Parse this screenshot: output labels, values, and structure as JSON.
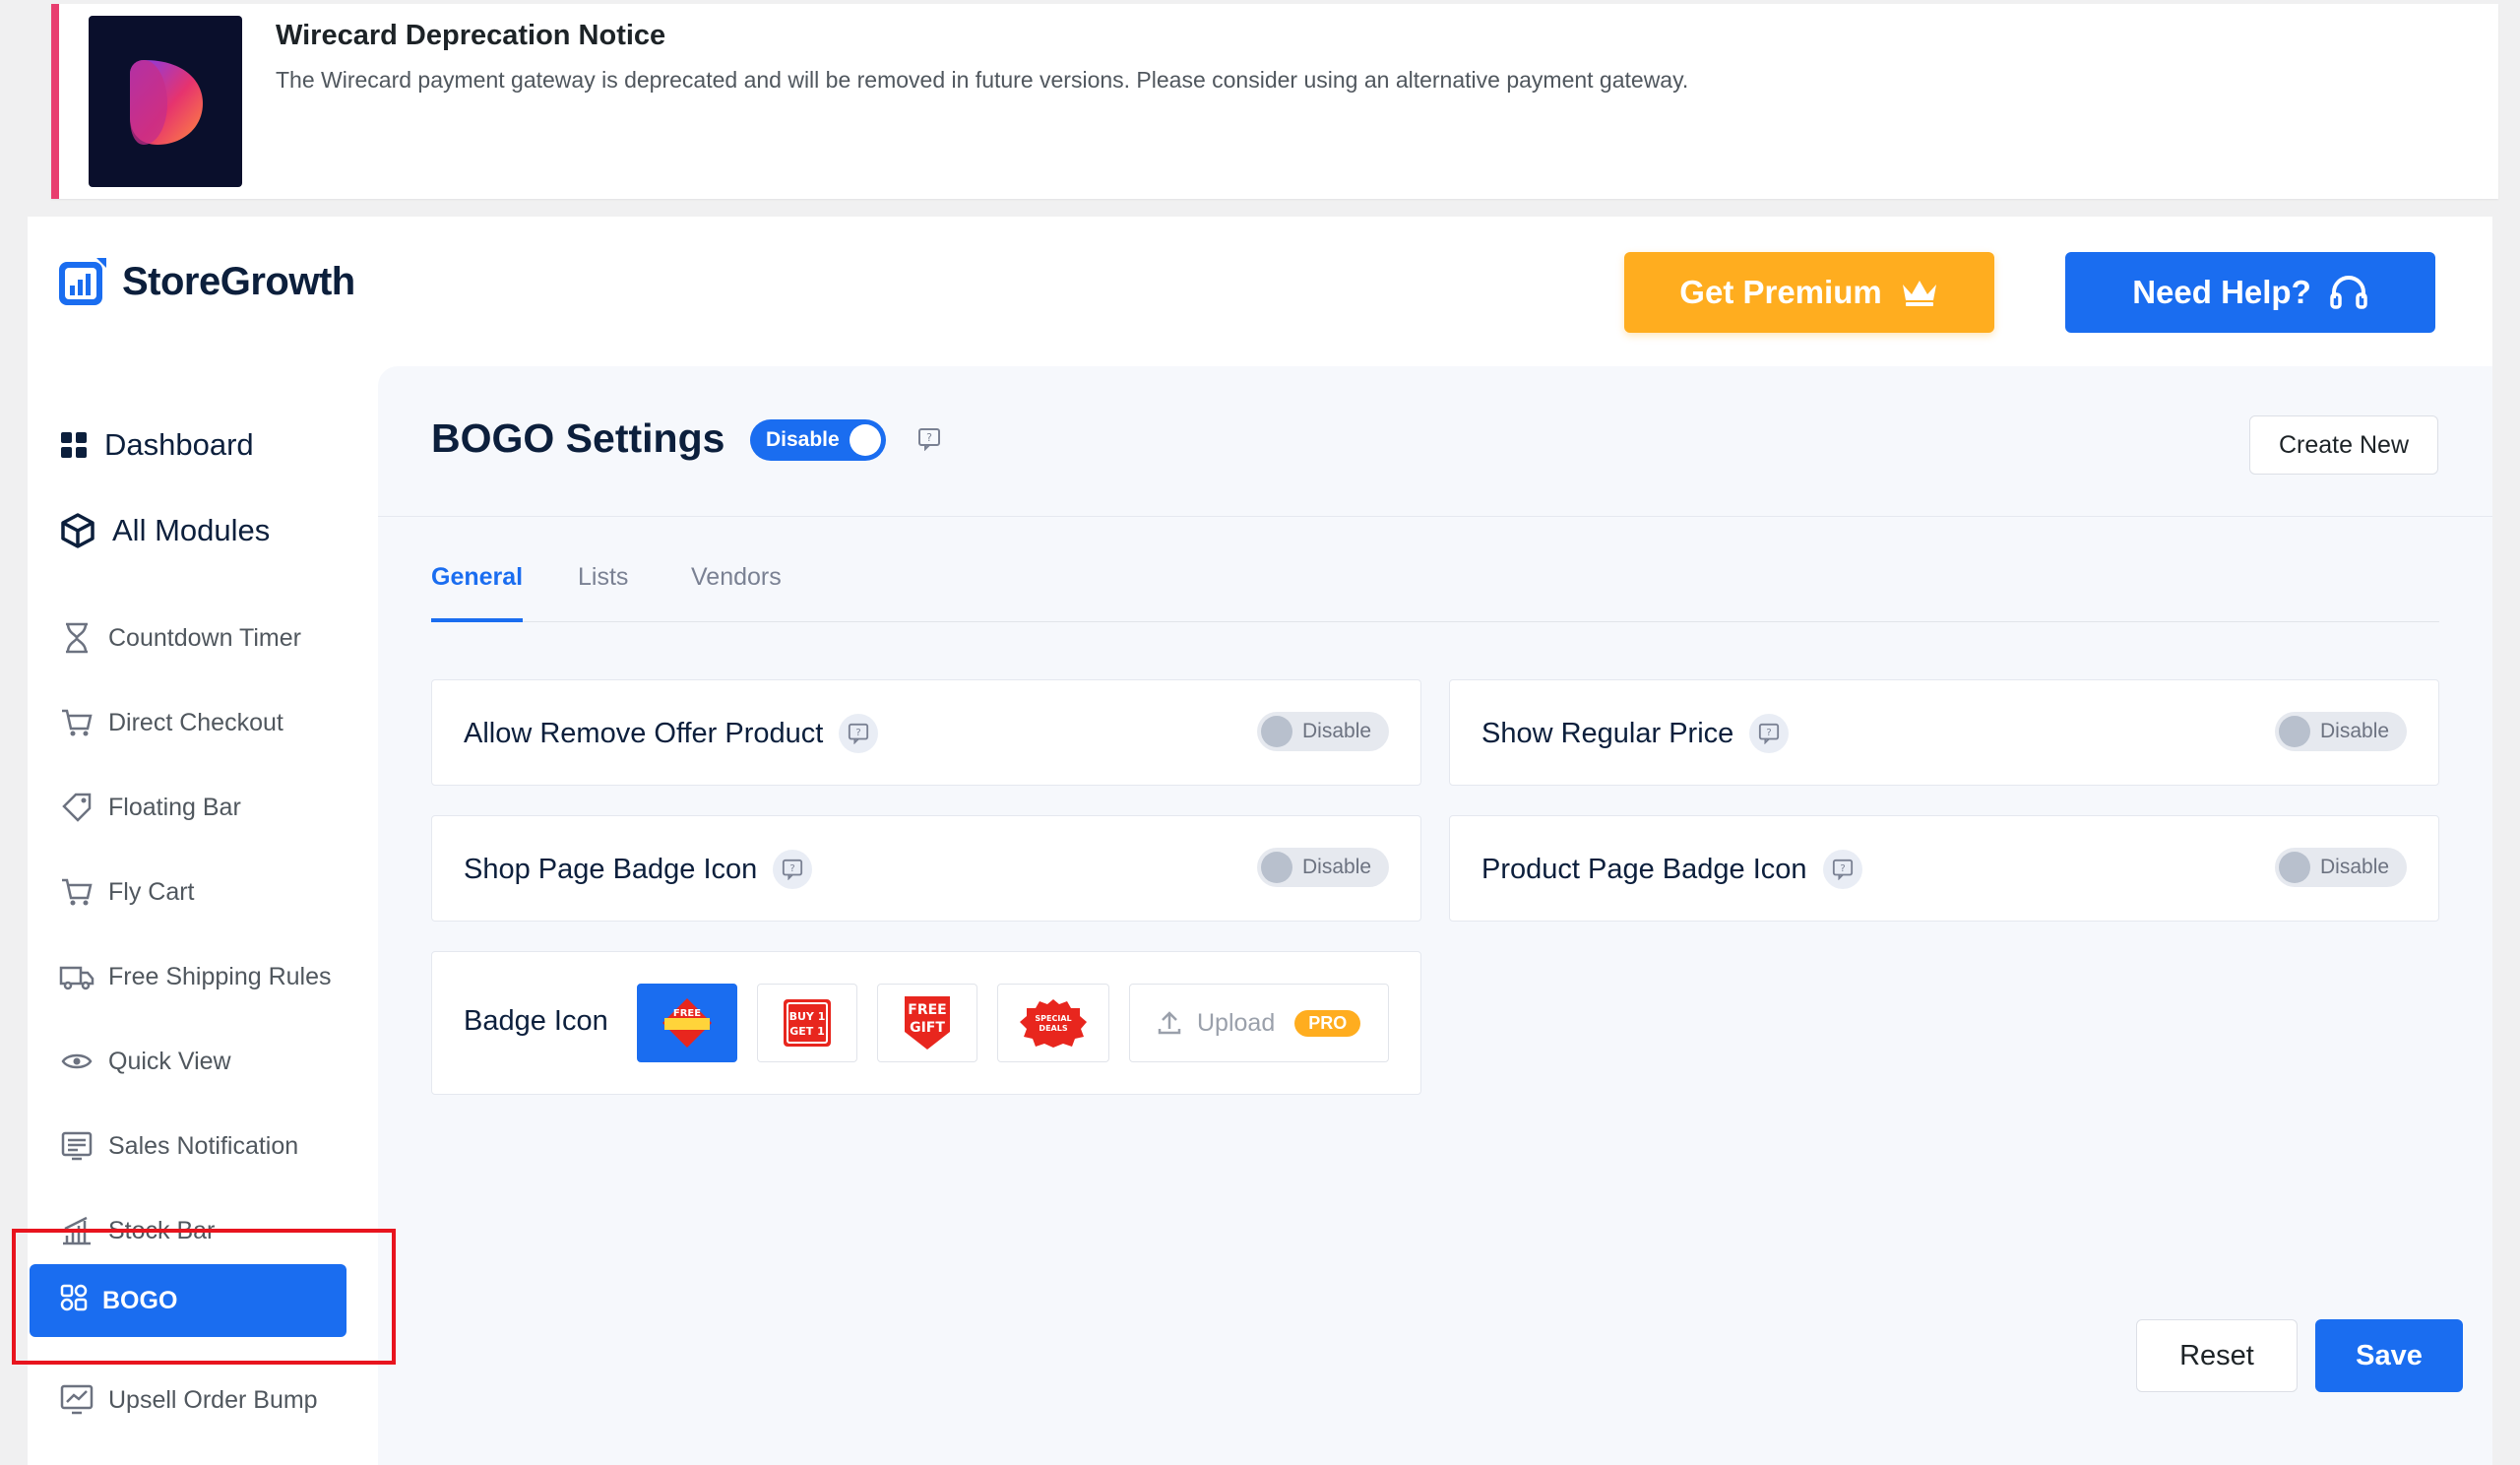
{
  "notice": {
    "title": "Wirecard Deprecation Notice",
    "text": "The Wirecard payment gateway is deprecated and will be removed in future versions. Please consider using an alternative payment gateway."
  },
  "brand": {
    "name": "StoreGrowth"
  },
  "header": {
    "premium_label": "Get Premium",
    "help_label": "Need Help?"
  },
  "sidebar": {
    "dashboard": "Dashboard",
    "all_modules": "All Modules",
    "items": [
      {
        "label": "Countdown Timer",
        "icon": "hourglass-icon"
      },
      {
        "label": "Direct Checkout",
        "icon": "cart-icon"
      },
      {
        "label": "Floating Bar",
        "icon": "tag-icon"
      },
      {
        "label": "Fly Cart",
        "icon": "cart-icon"
      },
      {
        "label": "Free Shipping Rules",
        "icon": "truck-icon"
      },
      {
        "label": "Quick View",
        "icon": "eye-icon"
      },
      {
        "label": "Sales Notification",
        "icon": "notification-icon"
      },
      {
        "label": "Stock Bar",
        "icon": "bar-chart-icon"
      },
      {
        "label": "BOGO",
        "icon": "bogo-icon",
        "active": true
      },
      {
        "label": "Upsell Order Bump",
        "icon": "chart-up-icon"
      }
    ]
  },
  "main": {
    "title": "BOGO Settings",
    "status_toggle": "Disable",
    "create_label": "Create New",
    "tabs": [
      {
        "label": "General",
        "active": true
      },
      {
        "label": "Lists",
        "active": false
      },
      {
        "label": "Vendors",
        "active": false
      }
    ],
    "settings": {
      "allow_remove": {
        "label": "Allow Remove Offer Product",
        "state": "Disable"
      },
      "show_regular_price": {
        "label": "Show Regular Price",
        "state": "Disable"
      },
      "shop_badge": {
        "label": "Shop Page Badge Icon",
        "state": "Disable"
      },
      "product_badge": {
        "label": "Product Page Badge Icon",
        "state": "Disable"
      }
    },
    "badge": {
      "label": "Badge Icon",
      "options": [
        {
          "text": "FREE",
          "selected": true
        },
        {
          "text1": "BUY 1",
          "text2": "GET 1"
        },
        {
          "text1": "FREE",
          "text2": "GIFT"
        },
        {
          "text1": "SPECIAL",
          "text2": "DEALS"
        }
      ],
      "upload_label": "Upload",
      "pro_label": "PRO"
    },
    "reset_label": "Reset",
    "save_label": "Save"
  },
  "colors": {
    "primary": "#1a6df0",
    "premium": "#ffad1f",
    "notice_accent": "#e83e6f",
    "highlight": "#e8141e"
  }
}
